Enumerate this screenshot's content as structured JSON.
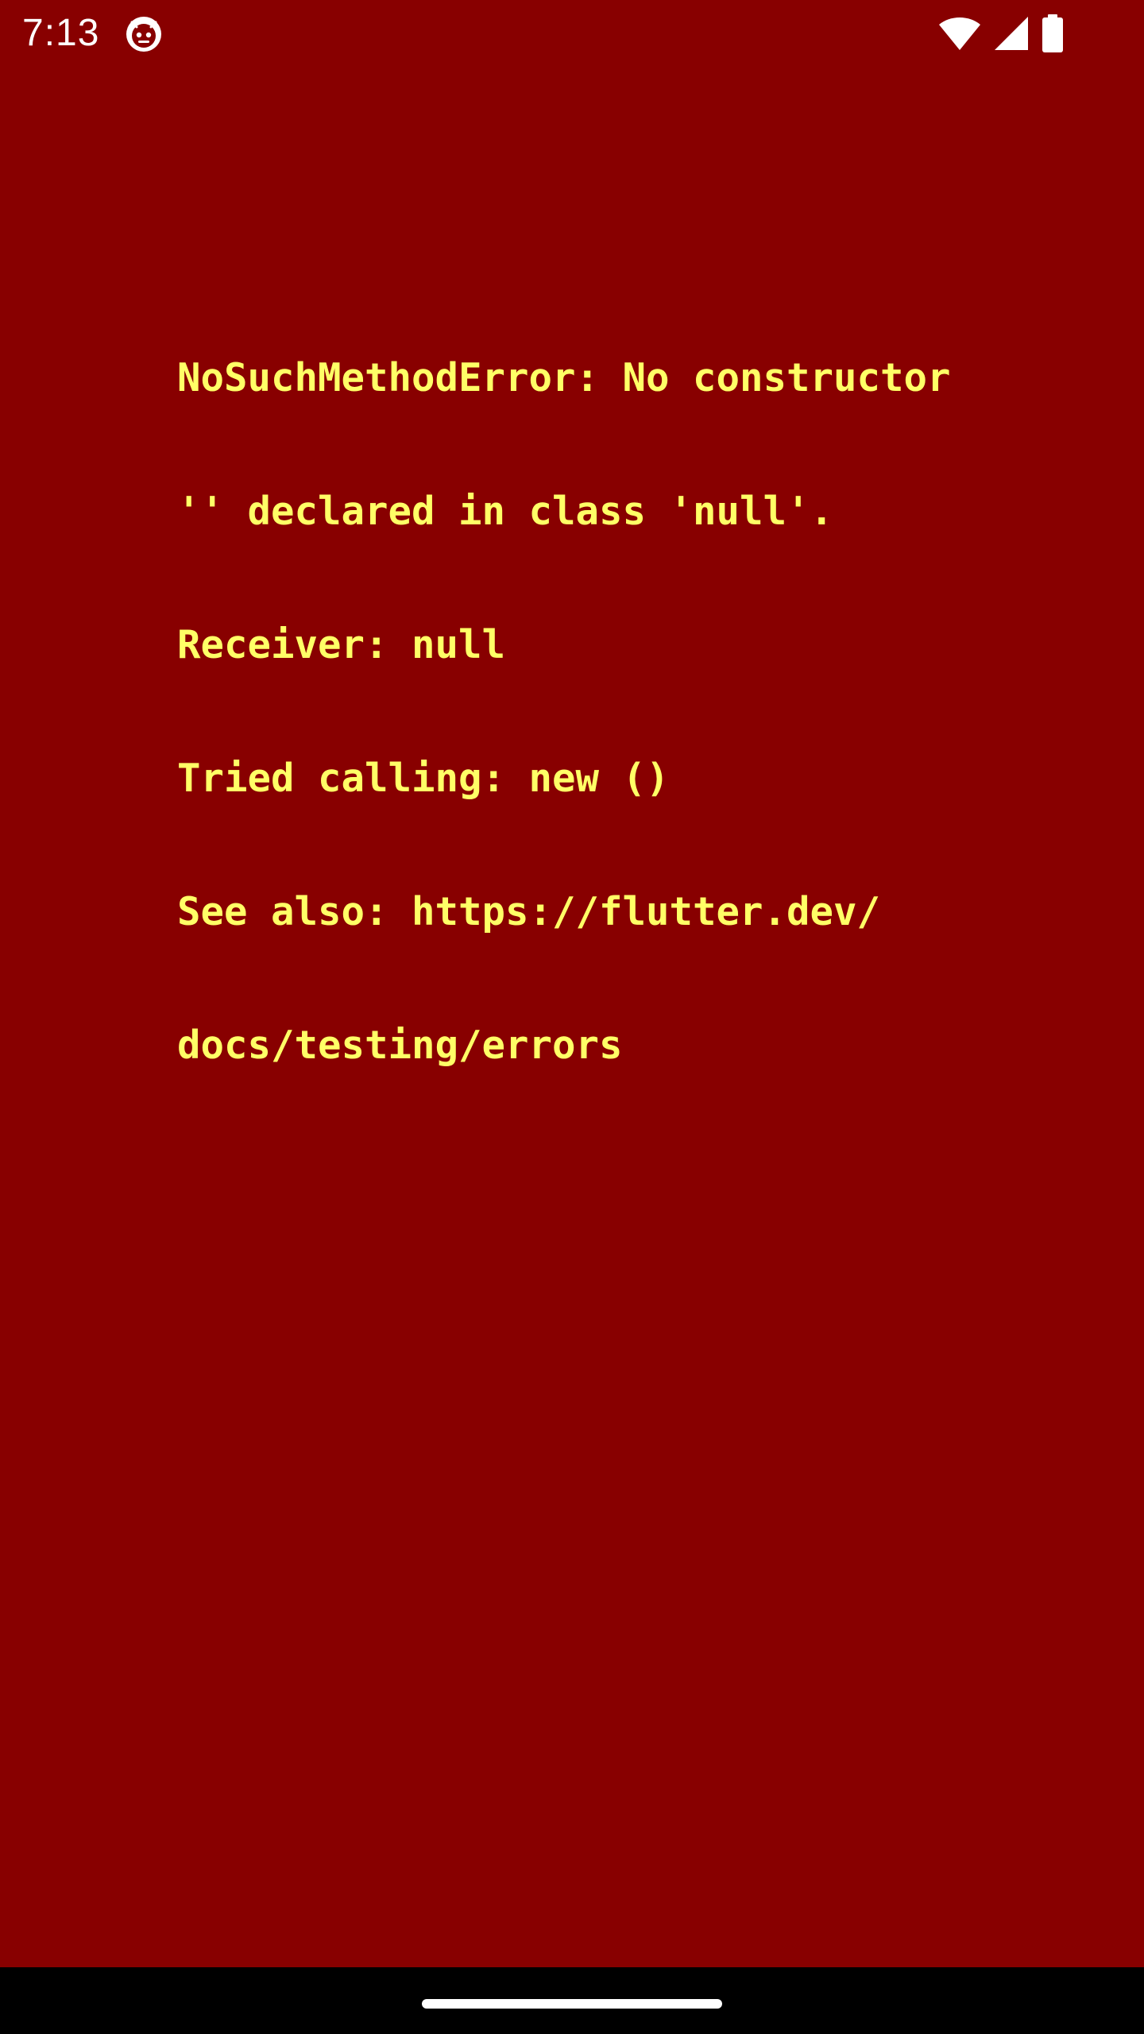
{
  "status_bar": {
    "time": "7:13",
    "notification_icon": "robot-face-icon",
    "wifi_icon": "wifi-icon",
    "signal_icon": "cellular-signal-icon",
    "battery_icon": "battery-icon"
  },
  "error": {
    "lines": [
      "NoSuchMethodError: No constructor",
      "'' declared in class 'null'.",
      "Receiver: null",
      "Tried calling: new ()",
      "See also: https://flutter.dev/",
      "docs/testing/errors"
    ],
    "background_color": "#880000",
    "text_color": "#ffff66"
  },
  "nav_bar": {
    "handle_icon": "home-gesture-handle"
  }
}
